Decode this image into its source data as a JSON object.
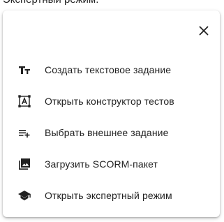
{
  "background_label": "Экспертный режим.",
  "dialog": {
    "close_label": "close",
    "items": [
      {
        "label": "Создать текстовое задание",
        "icon": "text-fields-icon"
      },
      {
        "label": "Открыть конструктор тестов",
        "icon": "quiz-constructor-icon"
      },
      {
        "label": "Выбрать внешнее задание",
        "icon": "playlist-add-icon"
      },
      {
        "label": "Загрузить SCORM-пакет",
        "icon": "photo-library-icon"
      },
      {
        "label": "Открыть экспертный режим",
        "icon": "school-icon"
      }
    ]
  },
  "colors": {
    "icon": "#212121",
    "text": "#212121"
  }
}
